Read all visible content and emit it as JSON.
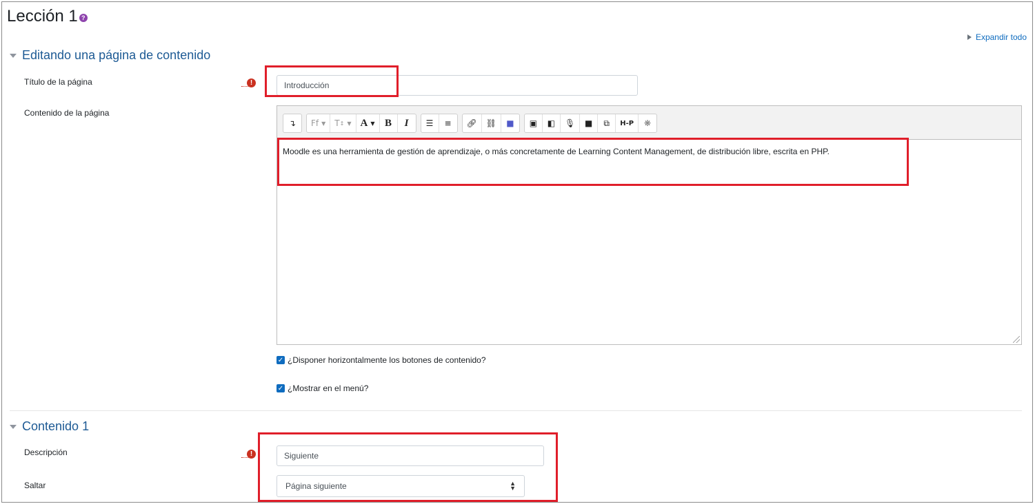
{
  "page": {
    "title": "Lección 1",
    "help_glyph": "?"
  },
  "expand_all_label": "Expandir todo",
  "section1": {
    "title": "Editando una página de contenido",
    "page_title_label": "Título de la página",
    "page_title_value": "Introducción",
    "page_content_label": "Contenido de la página",
    "editor_text": "Moodle es una herramienta de gestión de aprendizaje, o más concretamente de Learning Content Management, de distribución libre, escrita en PHP.",
    "toolbar": {
      "icons": [
        "expand-toolbar-icon",
        "font-family-icon",
        "font-size-icon",
        "font-color-icon",
        "bold-icon",
        "italic-icon",
        "unordered-list-icon",
        "ordered-list-icon",
        "link-icon",
        "unlink-icon",
        "teams-meeting-icon",
        "image-icon",
        "media-icon",
        "record-audio-icon",
        "record-video-icon",
        "manage-files-icon",
        "h5p-icon",
        "accessibility-icon"
      ]
    },
    "checkbox1_label": "¿Disponer horizontalmente los botones de contenido?",
    "checkbox2_label": "¿Mostrar en el menú?"
  },
  "section2": {
    "title": "Contenido 1",
    "description_label": "Descripción",
    "description_value": "Siguiente",
    "jump_label": "Saltar",
    "jump_value": "Página siguiente"
  },
  "required_glyph": "!",
  "colors": {
    "highlight": "#e01e2a",
    "link": "#0f6cbf",
    "section_heading": "#1d5a94",
    "required": "#ca3120"
  }
}
